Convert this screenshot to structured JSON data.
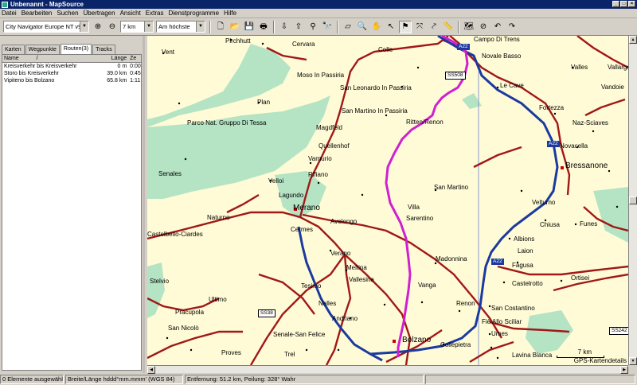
{
  "window": {
    "title": "Unbenannt - MapSource"
  },
  "menu": [
    "Datei",
    "Bearbeiten",
    "Suchen",
    "Übertragen",
    "Ansicht",
    "Extras",
    "Dienstprogramme",
    "Hilfe"
  ],
  "toolbar": {
    "map_product": "City Navigator Europe NT v9",
    "zoom_value": "7 km",
    "detail_value": "Am höchste"
  },
  "panel": {
    "tabs": [
      "Karten",
      "Wegpunkte",
      "Routen(3)",
      "Tracks"
    ],
    "active_tab": 2,
    "columns": [
      "Name",
      "/",
      "Länge",
      "Ze"
    ],
    "routes": [
      {
        "name": "Kreisverkehr bis Kreisverkehr",
        "length": "0 m",
        "time": "0:00:0"
      },
      {
        "name": "Storo bis Kreisverkehr",
        "length": "39.0 km",
        "time": "0:45:4"
      },
      {
        "name": "Vipiteno bis Bolzano",
        "length": "65.8 km",
        "time": "1:11:3"
      }
    ]
  },
  "map": {
    "colors": {
      "background": "#fffbd6",
      "forest": "#b4e4c4",
      "route": "#d020d0",
      "motorway": "#1a3aa0",
      "road": "#a01818"
    },
    "places": [
      {
        "name": "Pirchhutt"
      },
      {
        "name": "Cervara"
      },
      {
        "name": "Colle"
      },
      {
        "name": "Vent"
      },
      {
        "name": "Moso In Passiria"
      },
      {
        "name": "San Leonardo In Passiria"
      },
      {
        "name": "Plan"
      },
      {
        "name": "San Martino In Passiria"
      },
      {
        "name": "Parco Nat. Gruppo Di Tessa"
      },
      {
        "name": "Magdfeld"
      },
      {
        "name": "Quellenhof"
      },
      {
        "name": "Varnurio"
      },
      {
        "name": "Rifiano"
      },
      {
        "name": "Senales"
      },
      {
        "name": "Velloi"
      },
      {
        "name": "Lagundo"
      },
      {
        "name": "Merano"
      },
      {
        "name": "Naturno"
      },
      {
        "name": "Avelengo"
      },
      {
        "name": "Castelbello-Ciardes"
      },
      {
        "name": "Cermes"
      },
      {
        "name": "Verano"
      },
      {
        "name": "Meltina"
      },
      {
        "name": "Vallesina"
      },
      {
        "name": "Stelvio"
      },
      {
        "name": "Tesimo"
      },
      {
        "name": "Ultimo"
      },
      {
        "name": "Nalles"
      },
      {
        "name": "Pracupola"
      },
      {
        "name": "Andriano"
      },
      {
        "name": "San Nicolò"
      },
      {
        "name": "Senale-San Felice"
      },
      {
        "name": "Proves"
      },
      {
        "name": "Trel"
      },
      {
        "name": "Ritten/Renon"
      },
      {
        "name": "Villa"
      },
      {
        "name": "Sarentino"
      },
      {
        "name": "San Martino"
      },
      {
        "name": "Madonnina"
      },
      {
        "name": "Vanga"
      },
      {
        "name": "Renon"
      },
      {
        "name": "Bolzano"
      },
      {
        "name": "Collepietra"
      },
      {
        "name": "Campo Di Trens"
      },
      {
        "name": "Novale Basso"
      },
      {
        "name": "Valles"
      },
      {
        "name": "Vallarge"
      },
      {
        "name": "Le Cave"
      },
      {
        "name": "Vandoie"
      },
      {
        "name": "Fortezza"
      },
      {
        "name": "Naz-Sciaves"
      },
      {
        "name": "Novacella"
      },
      {
        "name": "Bressanone"
      },
      {
        "name": "Velturno"
      },
      {
        "name": "Funes"
      },
      {
        "name": "Chiusa"
      },
      {
        "name": "Albions"
      },
      {
        "name": "Laion"
      },
      {
        "name": "Ortisei"
      },
      {
        "name": "Fagusa"
      },
      {
        "name": "Castelrotto"
      },
      {
        "name": "San Costantino"
      },
      {
        "name": "Fiè Allo Sciliar"
      },
      {
        "name": "Umes"
      },
      {
        "name": "Lavina Bianca"
      }
    ],
    "badges": [
      {
        "text": "A22",
        "kind": "motorway"
      },
      {
        "text": "A22",
        "kind": "motorway"
      },
      {
        "text": "A22",
        "kind": "motorway"
      },
      {
        "text": "SS508",
        "kind": "state"
      },
      {
        "text": "SS38",
        "kind": "state"
      },
      {
        "text": "SS242",
        "kind": "state"
      }
    ],
    "scale_label": "7 km",
    "detail_label": "GPS-Kartendetails"
  },
  "status": {
    "selected": "0 Elemente ausgewählt",
    "format": "Breite/Länge hddd°mm.mmm' (WGS 84)",
    "distance": "Entfernung: 51.2 km, Peilung: 328° Wahr"
  }
}
